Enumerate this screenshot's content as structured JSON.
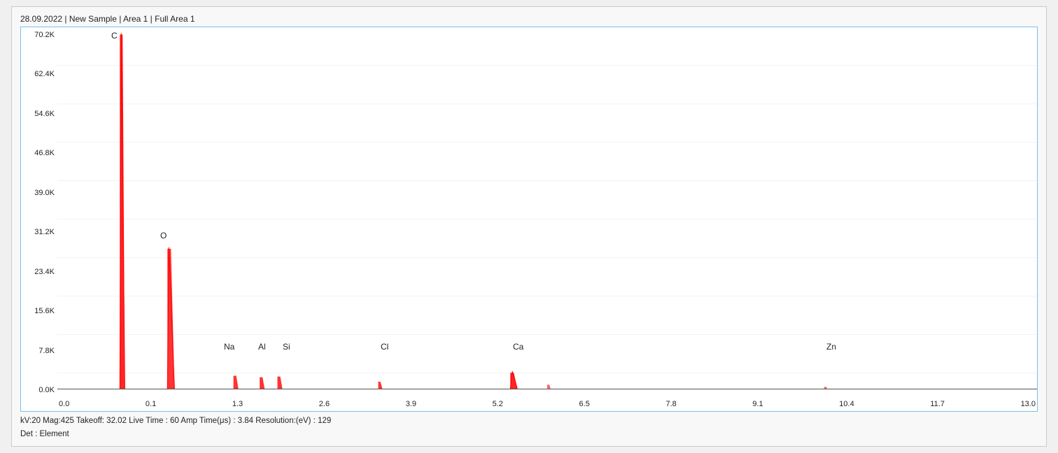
{
  "title": "28.09.2022 | New Sample | Area 1 | Full Area 1",
  "yAxis": {
    "labels": [
      "70.2K",
      "62.4K",
      "54.6K",
      "46.8K",
      "39.0K",
      "31.2K",
      "23.4K",
      "15.6K",
      "7.8K",
      "0.0K"
    ]
  },
  "xAxis": {
    "labels": [
      "0.0",
      "0.1",
      "1.3",
      "2.6",
      "3.9",
      "5.2",
      "6.5",
      "7.8",
      "9.1",
      "10.4",
      "11.7",
      "13.0"
    ]
  },
  "elements": [
    {
      "symbol": "C",
      "x_pct": 7.5,
      "y_pct": 6
    },
    {
      "symbol": "O",
      "x_pct": 13.5,
      "y_pct": 33
    },
    {
      "symbol": "Na",
      "x_pct": 19.5,
      "y_pct": 86
    },
    {
      "symbol": "Al",
      "x_pct": 22.8,
      "y_pct": 86
    },
    {
      "symbol": "Si",
      "x_pct": 25.2,
      "y_pct": 86
    },
    {
      "symbol": "Cl",
      "x_pct": 35.8,
      "y_pct": 86
    },
    {
      "symbol": "Ca",
      "x_pct": 50.5,
      "y_pct": 86
    },
    {
      "symbol": "Zn",
      "x_pct": 84.5,
      "y_pct": 86
    }
  ],
  "footer": {
    "line1": "kV:20    Mag:425    Takeoff: 32.02    Live Time : 60    Amp Time(μs) : 3.84    Resolution:(eV) : 129",
    "line2": "Det : Element"
  }
}
